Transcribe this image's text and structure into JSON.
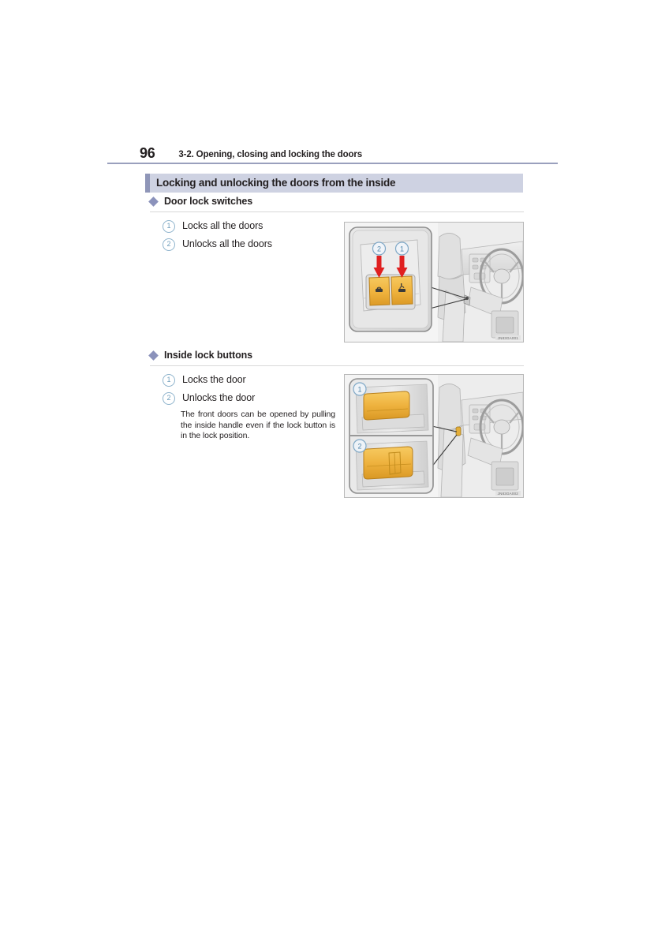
{
  "page": {
    "number": "96",
    "running_head": "3-2. Opening, closing and locking the doors"
  },
  "section": {
    "title": "Locking and unlocking the doors from the inside",
    "accent_color": "#8f96b8",
    "bar_color": "#ced2e2"
  },
  "subsections": [
    {
      "heading": "Door lock switches",
      "items": [
        {
          "number": "1",
          "label": "Locks all the doors"
        },
        {
          "number": "2",
          "label": "Unlocks all the doors"
        }
      ],
      "illustration": {
        "code": "JN83GA001",
        "callouts": [
          "2",
          "1"
        ],
        "alt": "Door lock switch panel on driver door armrest with two amber rocker switches and red arrows, plus vehicle interior view"
      }
    },
    {
      "heading": "Inside lock buttons",
      "items": [
        {
          "number": "1",
          "label": "Locks the door"
        },
        {
          "number": "2",
          "label": "Unlocks the door"
        }
      ],
      "note": "The front doors can be opened by pulling the inside handle even if the lock button is in the lock position.",
      "illustration": {
        "code": "JN83GA002",
        "callouts": [
          "1",
          "2"
        ],
        "alt": "Two stacked views of the inside lock button in locked and unlocked position, plus vehicle interior view"
      }
    }
  ],
  "colors": {
    "button_amber": "#efb23c",
    "arrow_red": "#e02020",
    "callout_blue": "#6d9dbb",
    "rule_gray": "#d8d8d8",
    "head_rule": "#9aa0bd"
  }
}
